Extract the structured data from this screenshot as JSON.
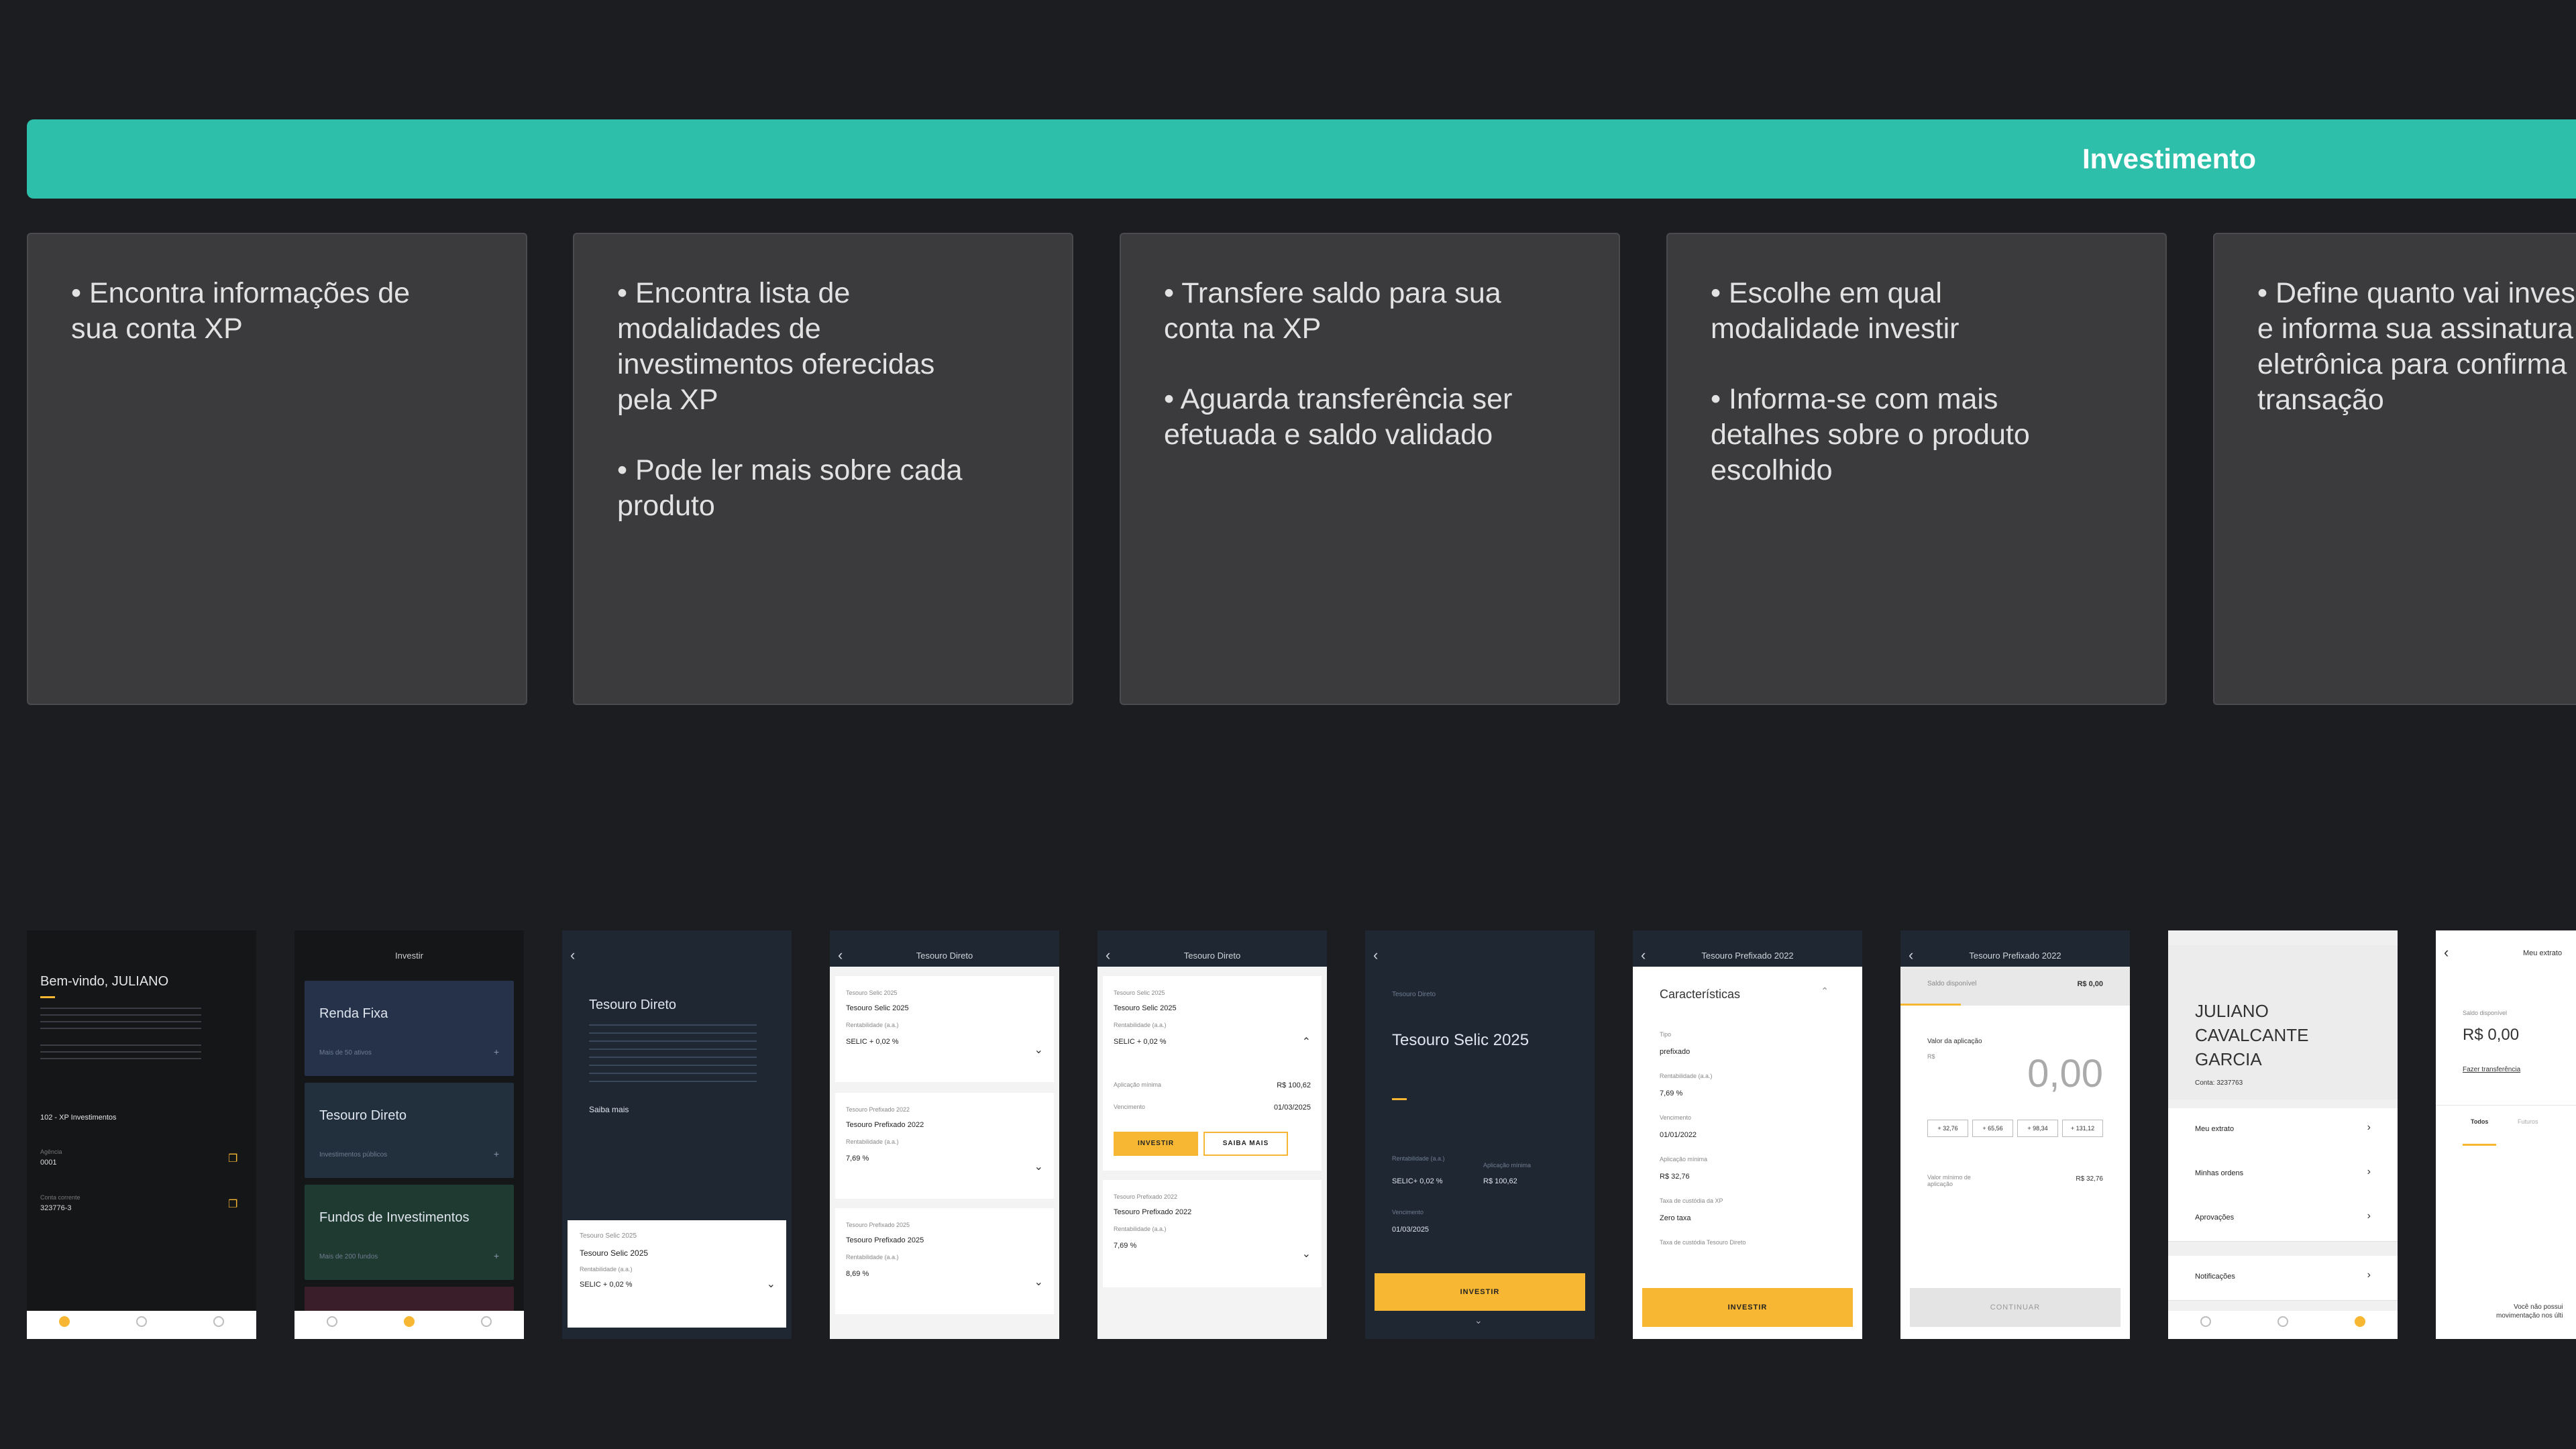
{
  "banner": {
    "title": "Investimento"
  },
  "cards": [
    {
      "lines": [
        "• Encontra informações de\nsua conta XP"
      ]
    },
    {
      "lines": [
        "• Encontra lista de\nmodalidades de\ninvestimentos oferecidas\npela XP",
        "• Pode ler mais sobre cada\nproduto"
      ]
    },
    {
      "lines": [
        "• Transfere saldo para sua\nconta na XP",
        "• Aguarda transferência ser\nefetuada e saldo validado"
      ]
    },
    {
      "lines": [
        "• Escolhe em qual\nmodalidade investir",
        "• Informa-se com mais\ndetalhes sobre o produto\nescolhido"
      ]
    },
    {
      "lines": [
        "• Define quanto vai inves\ne informa sua assinatura\neletrônica para confirma\ntransação"
      ]
    }
  ],
  "screens": {
    "s1": {
      "greeting": "Bem-vindo, JULIANO",
      "bank": "102 - XP Investimentos",
      "agency_label": "Agência",
      "agency": "0001",
      "account_label": "Conta corrente",
      "account": "323776-3"
    },
    "s2": {
      "title": "Investir",
      "items": [
        "Renda Fixa",
        "Tesouro Direto",
        "Fundos de Investimentos"
      ],
      "subs": [
        "Mais de 50 ativos",
        "Investimentos públicos",
        "Mais de 200 fundos"
      ]
    },
    "s3": {
      "title": "Tesouro Direto",
      "link": "Saiba mais",
      "card_label": "Tesouro Selic 2025",
      "card_name": "Tesouro Selic 2025",
      "card_rate_label": "Rentabilidade (a.a.)",
      "card_rate": "SELIC + 0,02 %"
    },
    "s4": {
      "title": "Tesouro Direto",
      "c1": [
        "Tesouro Selic 2025",
        "Tesouro Selic 2025",
        "Rentabilidade (a.a.)",
        "SELIC + 0,02 %"
      ],
      "c2": [
        "Tesouro Prefixado 2022",
        "Tesouro Prefixado 2022",
        "Rentabilidade (a.a.)",
        "7,69 %"
      ],
      "c3": [
        "Tesouro Prefixado 2025",
        "Tesouro Prefixado 2025",
        "Rentabilidade (a.a.)",
        "8,69 %"
      ]
    },
    "s5": {
      "title": "Tesouro Direto",
      "c1": [
        "Tesouro Selic 2025",
        "Tesouro Selic 2025",
        "Rentabilidade (a.a.)",
        "SELIC + 0,02 %"
      ],
      "min_label": "Aplicação mínima",
      "min": "R$ 100,62",
      "venc_label": "Vencimento",
      "venc": "01/03/2025",
      "invest": "INVESTIR",
      "more": "SAIBA MAIS",
      "c2": [
        "Tesouro Prefixado 2022",
        "Tesouro Prefixado 2022",
        "Rentabilidade (a.a.)",
        "7,69 %"
      ]
    },
    "s6": {
      "sup": "Tesouro Direto",
      "title": "Tesouro Selic 2025",
      "rate_label": "Rentabilidade (a.a.)",
      "rate": "SELIC+ 0,02 %",
      "min_label": "Aplicação mínima",
      "min": "R$ 100,62",
      "venc_label": "Vencimento",
      "venc": "01/03/2025",
      "cta": "INVESTIR"
    },
    "s7": {
      "title": "Tesouro Prefixado 2022",
      "section": "Características",
      "f": [
        "Tipo",
        "prefixado",
        "Rentabilidade (a.a.)",
        "7,69 %",
        "Vencimento",
        "01/01/2022",
        "Aplicação mínima",
        "R$ 32,76",
        "Taxa de custódia da XP",
        "Zero taxa",
        "Taxa de custódia Tesouro Direto"
      ],
      "cta": "INVESTIR"
    },
    "s8": {
      "title": "Tesouro Prefixado 2022",
      "bal_label": "Saldo disponível",
      "bal": "R$ 0,00",
      "val_label": "Valor da aplicação",
      "currency": "R$",
      "amount": "0,00",
      "chips": [
        "+ 32,76",
        "+ 65,56",
        "+ 98,34",
        "+ 131,12"
      ],
      "min_label": "Valor mínimo de aplicação",
      "min": "R$ 32,76",
      "cta": "CONTINUAR"
    },
    "s9": {
      "name": "JULIANO CAVALCANTE GARCIA",
      "acct": "Conta: 3237763",
      "items": [
        "Meu extrato",
        "Minhas ordens",
        "Aprovações",
        "Notificações"
      ]
    },
    "s10": {
      "title": "Meu extrato",
      "bal_label": "Saldo disponível",
      "bal": "R$ 0,00",
      "link": "Fazer transferência",
      "tabs": [
        "Todos",
        "Futuros"
      ],
      "empty": "Você não possui\nmovimentação nos últi"
    }
  }
}
